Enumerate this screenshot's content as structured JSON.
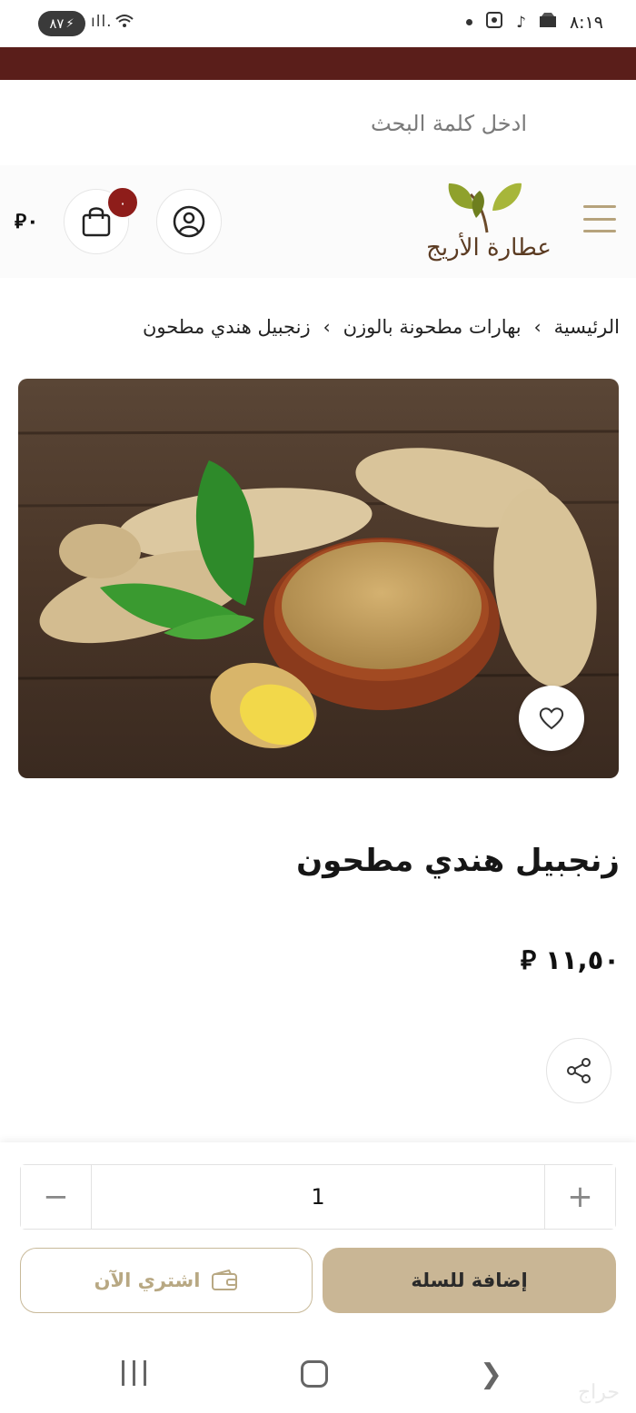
{
  "status_bar": {
    "battery": "٨٧",
    "time": "٨:١٩",
    "wifi_badge": "5"
  },
  "search": {
    "placeholder": "ادخل كلمة البحث"
  },
  "header": {
    "logo_text": "عطارة الأريج",
    "cart_count": "٠",
    "cart_total": "٠",
    "currency_symbol": "⃁"
  },
  "breadcrumb": {
    "items": [
      "الرئيسية",
      "بهارات مطحونة بالوزن",
      "زنجبيل هندي مطحون"
    ],
    "separator": "‹"
  },
  "product": {
    "title": "زنجبيل هندي مطحون",
    "price": "١١,٥٠",
    "image_alt": "زنجبيل هندي مطحون"
  },
  "quantity": {
    "value": "1",
    "minus": "−",
    "plus": "+"
  },
  "actions": {
    "buy_now": "اشتري الآن",
    "add_to_cart": "إضافة للسلة"
  },
  "watermark": "حراج",
  "colors": {
    "brand_strip": "#5a1e1a",
    "accent": "#c9b695",
    "badge": "#8e1d1a"
  }
}
